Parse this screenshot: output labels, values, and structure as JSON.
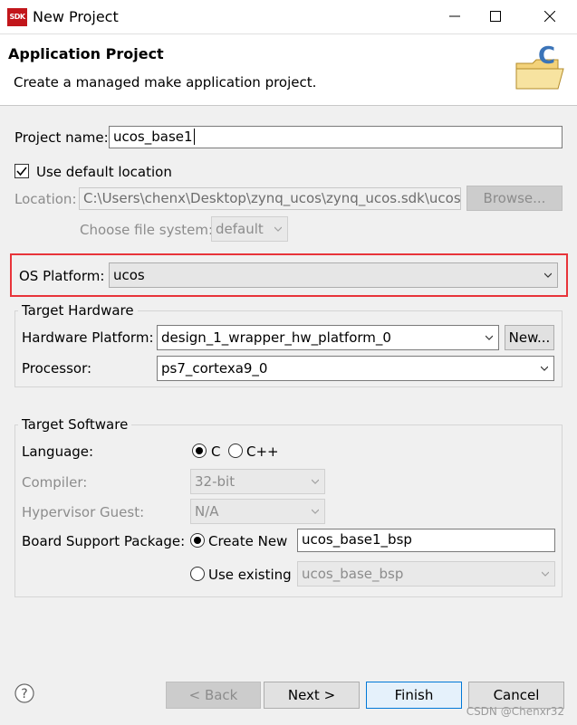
{
  "window": {
    "logo_text": "SDK",
    "title": "New Project"
  },
  "header": {
    "title": "Application Project",
    "subtitle": "Create a managed make application project."
  },
  "project": {
    "name_label": "Project name:",
    "name_value": "ucos_base1",
    "use_default_label": "Use default location",
    "use_default_checked": true,
    "location_label": "Location:",
    "location_value": "C:\\Users\\chenx\\Desktop\\zynq_ucos\\zynq_ucos.sdk\\ucos_",
    "browse_label": "Browse...",
    "filesystem_label": "Choose file system:",
    "filesystem_value": "default"
  },
  "os_platform": {
    "label": "OS Platform:",
    "value": "ucos"
  },
  "target_hardware": {
    "title": "Target Hardware",
    "platform_label": "Hardware Platform:",
    "platform_value": "design_1_wrapper_hw_platform_0",
    "new_label": "New...",
    "processor_label": "Processor:",
    "processor_value": "ps7_cortexa9_0"
  },
  "target_software": {
    "title": "Target Software",
    "language_label": "Language:",
    "lang_c": "C",
    "lang_cpp": "C++",
    "language_selected": "C",
    "compiler_label": "Compiler:",
    "compiler_value": "32-bit",
    "hypervisor_label": "Hypervisor Guest:",
    "hypervisor_value": "N/A",
    "bsp_label": "Board Support Package:",
    "create_new_label": "Create New",
    "create_new_value": "ucos_base1_bsp",
    "use_existing_label": "Use existing",
    "use_existing_value": "ucos_base_bsp"
  },
  "footer": {
    "back": "< Back",
    "next": "Next >",
    "finish": "Finish",
    "cancel": "Cancel"
  },
  "watermark": "CSDN @Chenxr32",
  "colors": {
    "highlight": "#e8343a",
    "accent": "#0078d7",
    "logo": "#c2161b"
  }
}
